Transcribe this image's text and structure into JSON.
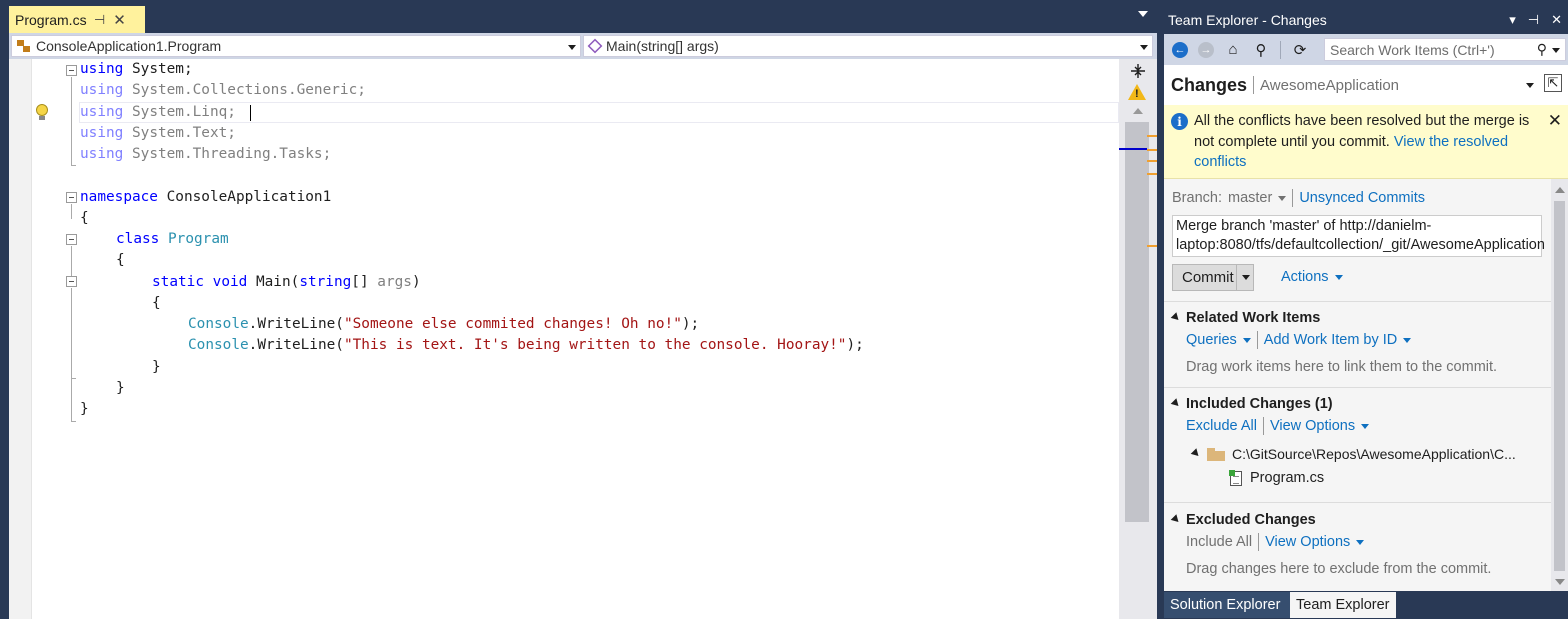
{
  "editor": {
    "tab": {
      "label": "Program.cs",
      "pin_glyph": "⊣",
      "close_glyph": "✕"
    },
    "nav": {
      "type_scope": "ConsoleApplication1.Program",
      "member_scope": "Main(string[] args)"
    },
    "code_lines": {
      "l1_kw": "using",
      "l1_rest": " System;",
      "l2_kw": "using",
      "l2_rest": " System.Collections.Generic;",
      "l3_kw": "using",
      "l3_rest": " System.Linq;",
      "l4_kw": "using",
      "l4_rest": " System.Text;",
      "l5_kw": "using",
      "l5_rest": " System.Threading.Tasks;",
      "l7_kw": "namespace",
      "l7_rest": " ConsoleApplication1",
      "l8": "{",
      "l9_kw": "class",
      "l9_ty": "Program",
      "l10": "{",
      "l11_kw1": "static",
      "l11_kw2": "void",
      "l11_name": "Main(",
      "l11_kw3": "string",
      "l11_arr": "[] ",
      "l11_arg": "args",
      "l11_close": ")",
      "l12": "{",
      "l13_ty": "Console",
      "l13_call": ".WriteLine(",
      "l13_str": "\"Someone else commited changes! Oh no!\"",
      "l13_end": ");",
      "l14_ty": "Console",
      "l14_call": ".WriteLine(",
      "l14_str": "\"This is text. It's being written to the console. Hooray!\"",
      "l14_end": ");",
      "l15": "}",
      "l16": "}",
      "l17": "}"
    },
    "warning_glyph": "!"
  },
  "team_explorer": {
    "title": "Team Explorer - Changes",
    "title_ctrls": {
      "dropdown": "▾",
      "pin": "⊣",
      "close": "✕"
    },
    "toolbar": {
      "back": "←",
      "forward": "→",
      "home": "⌂",
      "connect": "⚲",
      "refresh": "⟳"
    },
    "search": {
      "placeholder": "Search Work Items (Ctrl+')",
      "icon": "⚲"
    },
    "header": {
      "title": "Changes",
      "repo": "AwesomeApplication",
      "popout": "⇱"
    },
    "banner": {
      "info": "i",
      "message": "All the conflicts have been resolved but the merge is not complete until you commit.",
      "link": "View the resolved conflicts",
      "close": "✕"
    },
    "branch": {
      "label": "Branch:",
      "value": "master",
      "unsynced_link": "Unsynced Commits"
    },
    "commit_message": "Merge branch 'master' of http://danielm-laptop:8080/tfs/defaultcollection/_git/AwesomeApplication",
    "commit_button": "Commit",
    "actions": "Actions",
    "related_work_items": {
      "title": "Related Work Items",
      "queries": "Queries",
      "add": "Add Work Item by ID",
      "hint": "Drag work items here to link them to the commit."
    },
    "included_changes": {
      "title": "Included Changes (1)",
      "exclude_all": "Exclude All",
      "view_options": "View Options",
      "folder": "C:\\GitSource\\Repos\\AwesomeApplication\\C...",
      "file": "Program.cs"
    },
    "excluded_changes": {
      "title": "Excluded Changes",
      "include_all": "Include All",
      "view_options": "View Options",
      "hint": "Drag changes here to exclude from the commit."
    },
    "bottom_tabs": {
      "solution_explorer": "Solution Explorer",
      "team_explorer": "Team Explorer"
    }
  },
  "colors": {
    "keyword": "#0000ff",
    "type": "#2b91af",
    "string": "#a31515",
    "link": "#0e70c0",
    "tab_active": "#fff29d",
    "chrome": "#293955"
  }
}
